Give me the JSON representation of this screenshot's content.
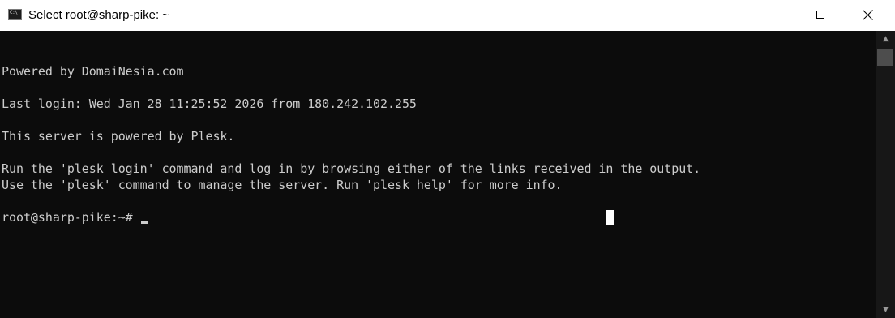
{
  "window": {
    "title": "Select root@sharp-pike: ~",
    "app_icon": "terminal-icon",
    "buttons": {
      "minimize": "minimize-icon",
      "maximize": "maximize-icon",
      "close": "close-icon"
    }
  },
  "terminal": {
    "lines": [
      "Powered by DomaiNesia.com",
      "Last login: Wed Jan 28 11:25:52 2026 from 180.242.102.255",
      "This server is powered by Plesk.",
      "Run the 'plesk login' command and log in by browsing either of the links received in the output.",
      "Use the 'plesk' command to manage the server. Run 'plesk help' for more info."
    ],
    "prompt": "root@sharp-pike:~# "
  },
  "scrollbar": {
    "up_icon": "▲",
    "down_icon": "▼"
  },
  "colors": {
    "background": "#0c0c0c",
    "foreground": "#cccccc",
    "titlebar": "#ffffff"
  }
}
